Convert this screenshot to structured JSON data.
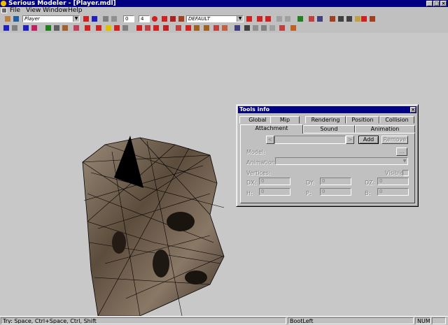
{
  "window": {
    "title": "Serious Modeler - [Player.mdl]"
  },
  "window_buttons": {
    "minimize": "_",
    "maximize": "□",
    "close": "×"
  },
  "menu": [
    {
      "label": "File"
    },
    {
      "label": "View"
    },
    {
      "label": "Window"
    },
    {
      "label": "Help"
    }
  ],
  "toolbar": {
    "model_combo": "Player",
    "frame_value": "0",
    "frame_count": "4",
    "skin_combo": "DEFAULT"
  },
  "status": {
    "hint": "Try: Space, Ctrl+Space, Ctrl, Shift",
    "animation": "BootLeft",
    "num": "NUM"
  },
  "tools_dialog": {
    "title": "Tools info",
    "close": "×",
    "tabs_row1": [
      "Global",
      "Mip",
      "Rendering",
      "Position",
      "Collision"
    ],
    "tabs_row2": [
      "Attachment",
      "Sound",
      "Animation"
    ],
    "active_tab": "Attachment",
    "prev_btn": "<",
    "next_btn": ">",
    "add_btn": "Add",
    "remove_btn": "Remove",
    "model_label": "Model:",
    "browse_btn": "...",
    "animation_label": "Animation:",
    "vertices_label": "Vertices:",
    "visible_label": "Visible",
    "fields": [
      {
        "label": "DX:",
        "value": "0"
      },
      {
        "label": "DY:",
        "value": "0"
      },
      {
        "label": "DZ:",
        "value": "0"
      },
      {
        "label": "H:",
        "value": "0"
      },
      {
        "label": "P:",
        "value": "0"
      },
      {
        "label": "B:",
        "value": "0"
      }
    ]
  },
  "colors": {
    "titlebar": "#000080",
    "face": "#c0c0c0",
    "viewport": "#c8c8c8",
    "model_metal": "#6b5a48"
  }
}
